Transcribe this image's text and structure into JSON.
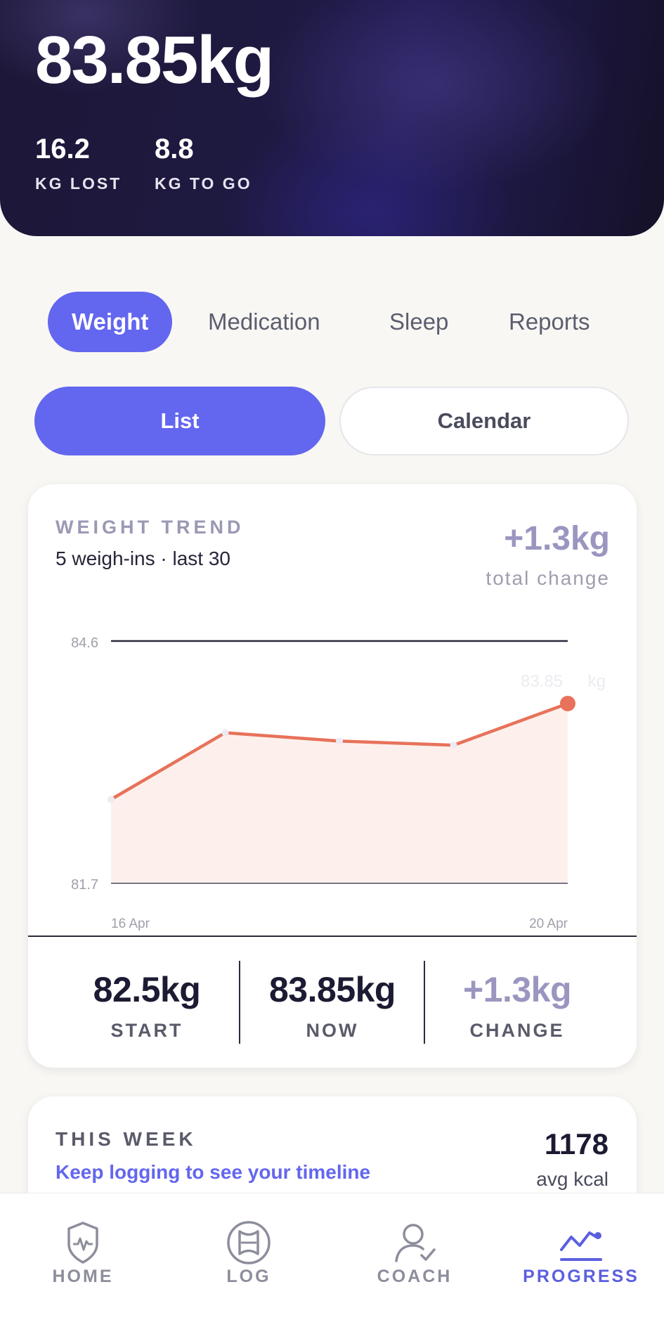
{
  "header": {
    "current_weight": "83.85kg",
    "stats": [
      {
        "value": "16.2",
        "label": "KG LOST"
      },
      {
        "value": "8.8",
        "label": "KG TO GO"
      }
    ]
  },
  "tabs": [
    {
      "label": "Weight",
      "active": true
    },
    {
      "label": "Medication",
      "active": false
    },
    {
      "label": "Sleep",
      "active": false
    },
    {
      "label": "Reports",
      "active": false
    }
  ],
  "view_toggle": {
    "list": "List",
    "calendar": "Calendar",
    "selected": "List"
  },
  "trend_card": {
    "title": "WEIGHT TREND",
    "subtitle": "5 weigh-ins · last 30",
    "total_change": "+1.3kg",
    "total_change_label": "total change",
    "stats": [
      {
        "value": "82.5kg",
        "label": "START",
        "color": "#1c1b33"
      },
      {
        "value": "83.85kg",
        "label": "NOW",
        "color": "#1c1b33"
      },
      {
        "value": "+1.3kg",
        "label": "CHANGE",
        "color": "#9a96c0"
      }
    ]
  },
  "chart_data": {
    "type": "area",
    "x": [
      "16 Apr",
      "17 Apr",
      "18 Apr",
      "19 Apr",
      "20 Apr"
    ],
    "values": [
      82.7,
      83.5,
      83.4,
      83.35,
      83.85
    ],
    "ylim": [
      81.7,
      84.6
    ],
    "y_ticks": [
      "84.6",
      "81.7"
    ],
    "x_tick_labels": [
      "16 Apr",
      "20 Apr"
    ],
    "last_point_label": "83.85",
    "unit_label": "kg",
    "line_color": "#e8725a",
    "fill_color": "#fdf0ec"
  },
  "week_card": {
    "title": "THIS WEEK",
    "message": "Keep logging to see your timeline",
    "value": "1178",
    "value_label": "avg kcal"
  },
  "bottom_nav": [
    {
      "label": "HOME",
      "icon": "shield-heart-icon",
      "active": false
    },
    {
      "label": "LOG",
      "icon": "log-circle-icon",
      "active": false
    },
    {
      "label": "COACH",
      "icon": "coach-person-icon",
      "active": false
    },
    {
      "label": "PROGRESS",
      "icon": "trend-chart-icon",
      "active": true
    }
  ],
  "colors": {
    "accent": "#6366ee",
    "chart_line": "#e8725a",
    "header_bg": "#1e1940"
  }
}
